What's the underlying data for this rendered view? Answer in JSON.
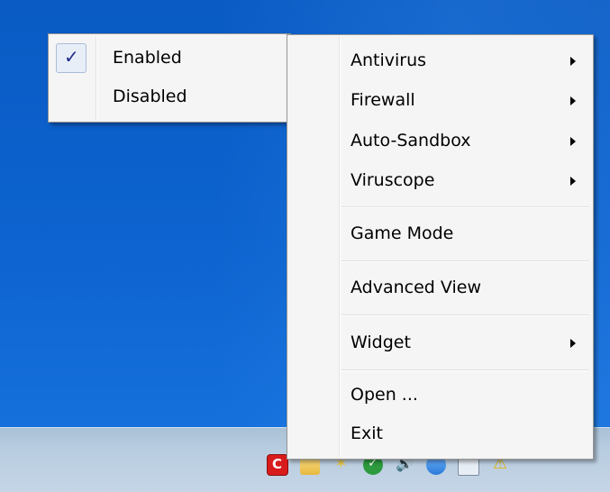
{
  "submenu": {
    "items": [
      {
        "label": "Enabled",
        "checked": true
      },
      {
        "label": "Disabled",
        "checked": false
      }
    ],
    "check_glyph": "✓"
  },
  "context_menu": {
    "items": [
      {
        "label": "Antivirus",
        "has_submenu": true
      },
      {
        "label": "Firewall",
        "has_submenu": true
      },
      {
        "label": "Auto-Sandbox",
        "has_submenu": true
      },
      {
        "label": "Viruscope",
        "has_submenu": true
      },
      {
        "label": "Game Mode",
        "has_submenu": false
      },
      {
        "label": "Advanced View",
        "has_submenu": false
      },
      {
        "label": "Widget",
        "has_submenu": true
      },
      {
        "label": "Open ...",
        "has_submenu": false
      },
      {
        "label": "Exit",
        "has_submenu": false
      }
    ]
  },
  "tray": {
    "icons": [
      "comodo-icon",
      "folder-icon",
      "star-icon",
      "security-check-icon",
      "speaker-icon",
      "network-icon",
      "monitor-icon",
      "warning-icon"
    ]
  },
  "colors": {
    "desktop": "#0b5fc9",
    "menu_bg": "#f5f5f5",
    "menu_border": "#979797",
    "check_color": "#1f2a8a",
    "taskbar": "#b9cde0"
  }
}
